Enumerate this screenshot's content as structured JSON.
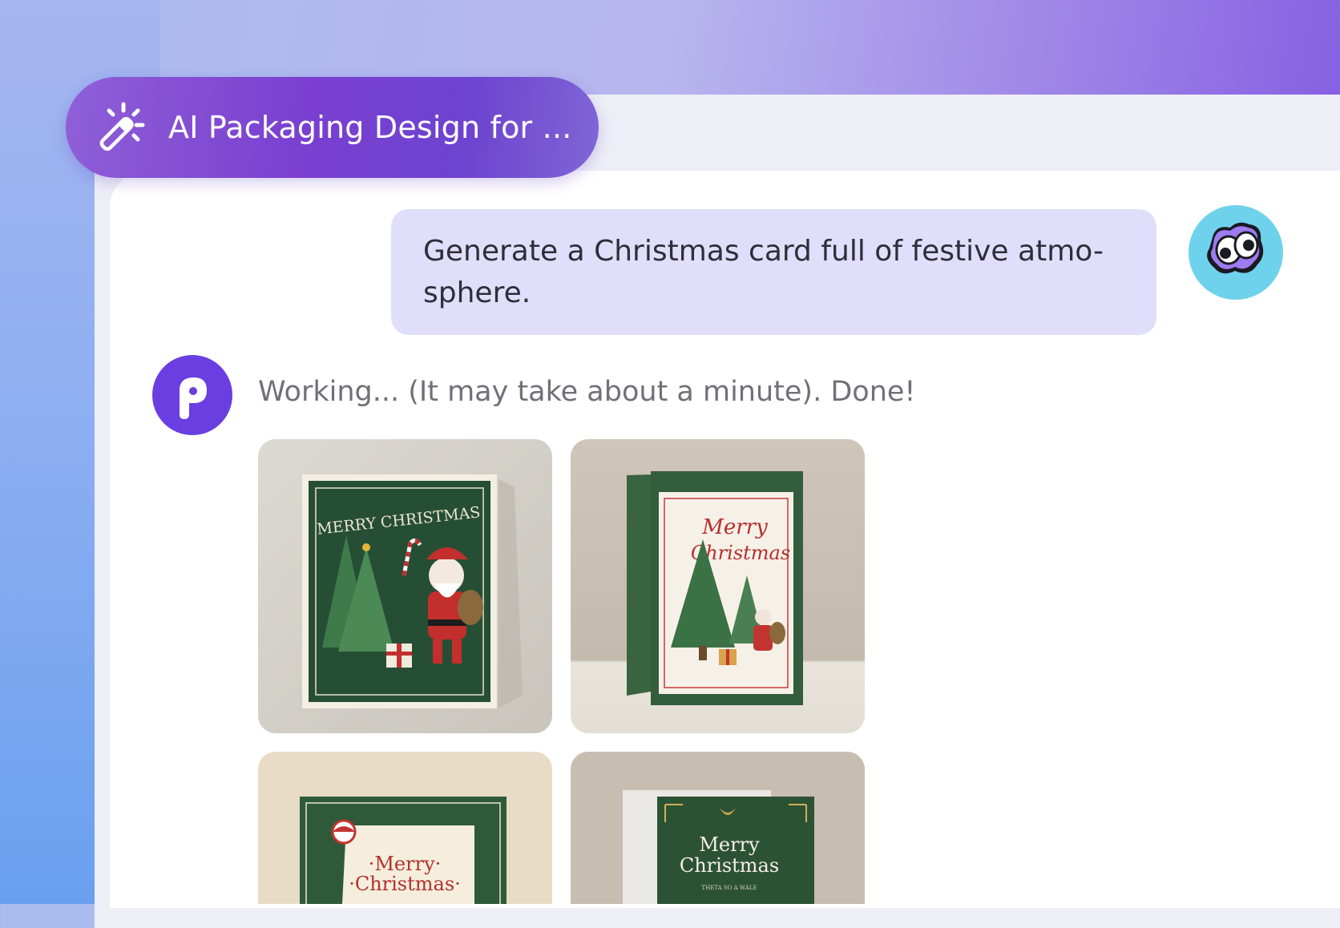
{
  "app": {
    "title": "AI Packaging Design for ..."
  },
  "conversation": {
    "user_message": "Generate a Christmas card full of festive atmo-\nsphere.",
    "assistant_status": "Working... (It may take about a minute). Done!"
  },
  "results": {
    "images": [
      {
        "alt": "card-1",
        "heading": "MERRY CHRISTMAS"
      },
      {
        "alt": "card-2",
        "heading_line1": "Merry",
        "heading_line2": "Christmas"
      },
      {
        "alt": "card-3",
        "heading_line1": "·Merry·",
        "heading_line2": "·Christmas·"
      },
      {
        "alt": "card-4",
        "heading_line1": "Merry",
        "heading_line2": "Christmas",
        "tagline": "THETA SO A WALE"
      }
    ]
  },
  "icons": {
    "title": "magic-wand-icon",
    "user_avatar": "googly-eyes-avatar",
    "bot_avatar": "p-logo-avatar"
  },
  "colors": {
    "accent": "#6a3ee0",
    "user_bubble": "#dfdffb",
    "card_green": "#2f5a3a",
    "card_red": "#b8312f"
  }
}
